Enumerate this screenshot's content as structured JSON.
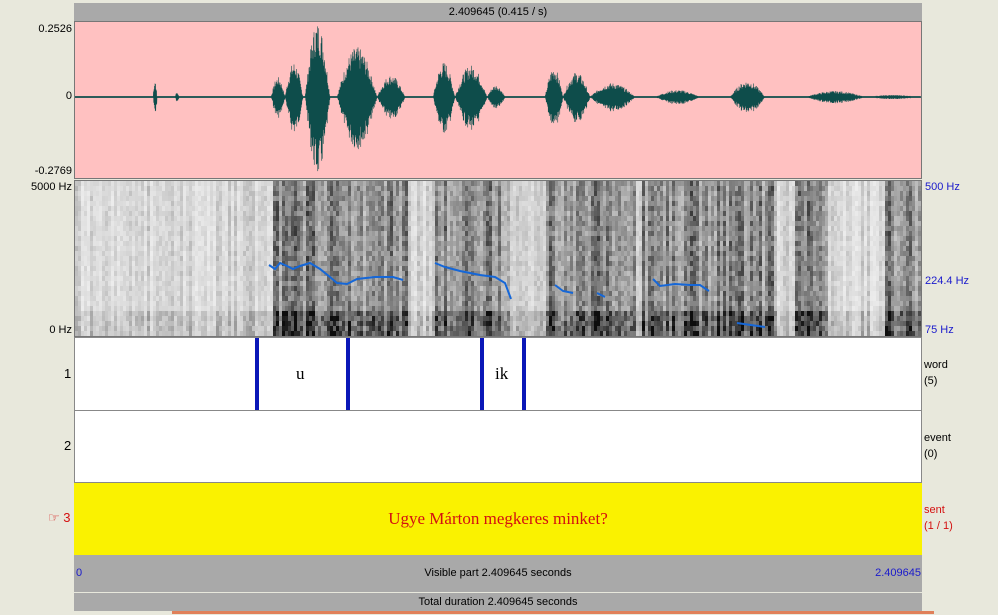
{
  "top_bar": {
    "label": "2.409645 (0.415 / s)"
  },
  "waveform": {
    "y_max": "0.2526",
    "y_zero": "0",
    "y_min": "-0.2769"
  },
  "spectrogram": {
    "freq_top_label": "5000 Hz",
    "freq_bottom_label": "0 Hz",
    "pitch_labels": {
      "top": "500 Hz",
      "mid": "224.4 Hz",
      "bottom": "75 Hz"
    }
  },
  "tiers": [
    {
      "number": "1",
      "name": "word",
      "count": "(5)",
      "intervals": [
        {
          "text": "u"
        },
        {
          "text": "ik"
        }
      ]
    },
    {
      "number": "2",
      "name": "event",
      "count": "(0)",
      "intervals": []
    },
    {
      "number": "☞ 3",
      "name": "sent",
      "count": "(1 / 1)",
      "intervals": [
        {
          "text": "Ugye Márton megkeres minket?"
        }
      ]
    }
  ],
  "visible_bar": {
    "start": "0",
    "label": "Visible part 2.409645 seconds",
    "end": "2.409645"
  },
  "total_bar": {
    "label": "Total duration 2.409645 seconds"
  },
  "colors": {
    "waveform_bg": "#ffc1c1",
    "waveform_line": "#0e4d4b",
    "pitch_line": "#1567d8",
    "boundary": "#0a17b8",
    "selected_tier_bg": "#faf200",
    "selected_tier_text": "#d41010",
    "pitch_label_color": "#1a1acc"
  }
}
